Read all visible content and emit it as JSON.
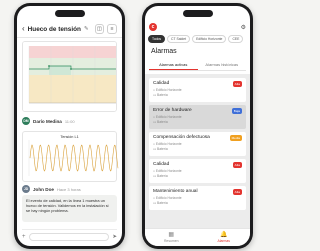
{
  "left": {
    "header": {
      "back_icon": "chevron-left-icon",
      "title": "Hueco de tensión",
      "edit_icon": "pencil-icon",
      "buttons": [
        "comment-icon",
        "menu-icon"
      ]
    },
    "messages": [
      {
        "initials": "DM",
        "name": "Darío Medina",
        "time": "11:00"
      },
      {
        "initials": "JD",
        "name": "John Doe",
        "time": "Hace 3 horas"
      }
    ],
    "oscillogram_title": "Tensión L1",
    "comment_text": "El evento de calidad, en la línea 1 muestra un hueco de tensión. Validemos en la instalación si se hay ningún problema.",
    "input_placeholder": ""
  },
  "right": {
    "filters": [
      {
        "label": "Todos",
        "active": true
      },
      {
        "label": "CT Saidet",
        "active": false
      },
      {
        "label": "Edificio Horizonte",
        "active": false
      },
      {
        "label": "CEE",
        "active": false
      }
    ],
    "title": "Alarmas",
    "tabs": [
      {
        "label": "Alarmas activas",
        "active": true
      },
      {
        "label": "Alarmas históricas",
        "active": false
      }
    ],
    "alarms": [
      {
        "name": "Calidad",
        "badge": "Alta",
        "badge_color": "#e3342f",
        "site": "Edificio Horizonte",
        "device": "Batería",
        "selected": false
      },
      {
        "name": "Error de hardware",
        "badge": "Baja",
        "badge_color": "#3f6fd8",
        "site": "Edificio Horizonte",
        "device": "Batería",
        "selected": true
      },
      {
        "name": "Compensación defectuosa",
        "badge": "Media",
        "badge_color": "#f0a020",
        "site": "Edificio Horizonte",
        "device": "Batería",
        "selected": false
      },
      {
        "name": "Calidad",
        "badge": "Alta",
        "badge_color": "#e3342f",
        "site": "Edificio Horizonte",
        "device": "Batería",
        "selected": false
      },
      {
        "name": "Mantenimiento anual",
        "badge": "Alta",
        "badge_color": "#e3342f",
        "site": "Edificio Horizonte",
        "device": "Batería",
        "selected": false
      }
    ],
    "tabbar": [
      {
        "label": "Resumen",
        "icon": "grid-icon",
        "active": false
      },
      {
        "label": "Alarmas",
        "icon": "bell-icon",
        "active": true
      }
    ]
  }
}
